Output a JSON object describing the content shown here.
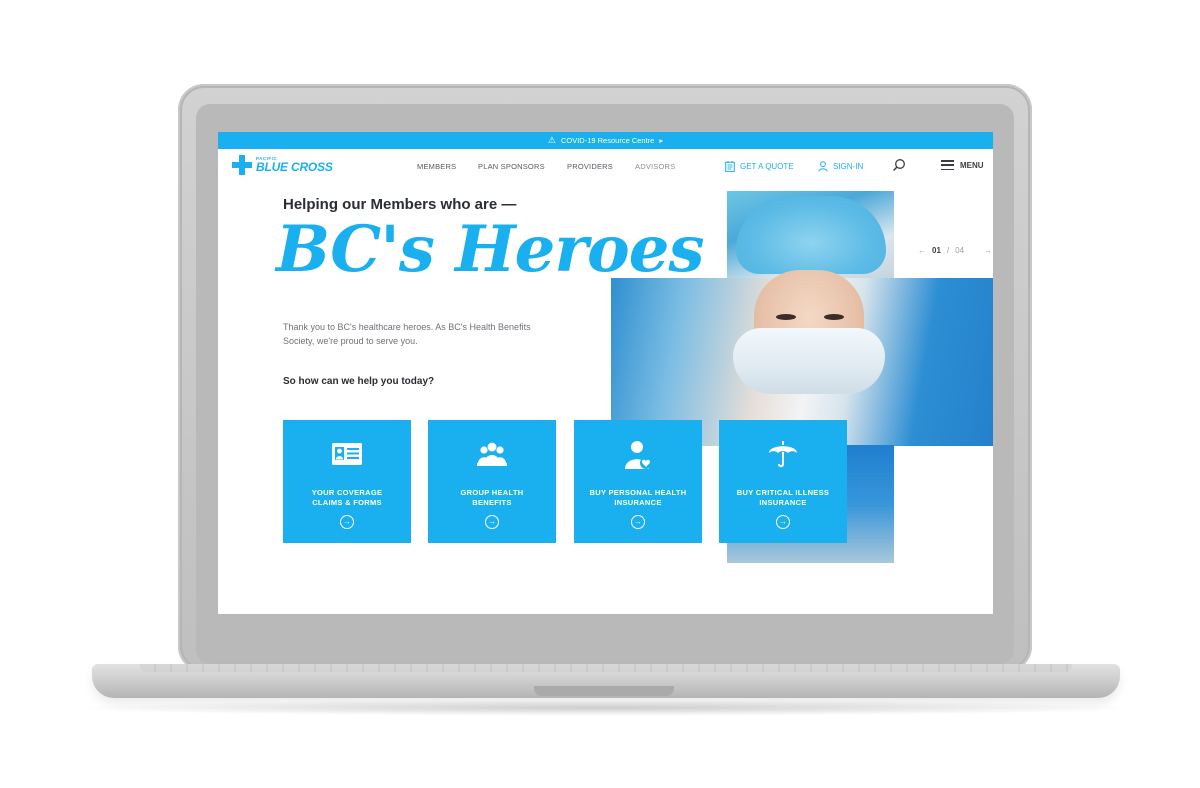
{
  "covid_bar": {
    "text": "COVID-19 Resource Centre",
    "arrow": "▸"
  },
  "logo": {
    "small": "PACIFIC",
    "big": "BLUE CROSS"
  },
  "nav": {
    "members": "MEMBERS",
    "plan_sponsors": "PLAN SPONSORS",
    "providers": "PROVIDERS",
    "advisors": "ADVISORS",
    "quote": "GET A QUOTE",
    "signin": "SIGN-IN",
    "menu": "MENU"
  },
  "hero": {
    "headline_small": "Helping our Members who are —",
    "headline_big": "BC's Heroes",
    "intro": "Thank you to BC's healthcare heroes. As BC's Health Benefits Society, we're proud to serve you.",
    "question": "So how can we help you today?"
  },
  "pager": {
    "prev": "←",
    "current": "01",
    "separator": "/",
    "total": "04",
    "next": "→"
  },
  "tiles": [
    {
      "line1": "YOUR COVERAGE",
      "line2": "CLAIMS & FORMS",
      "icon": "id-card-icon"
    },
    {
      "line1": "GROUP HEALTH",
      "line2": "BENEFITS",
      "icon": "group-icon"
    },
    {
      "line1": "BUY PERSONAL HEALTH",
      "line2": "INSURANCE",
      "icon": "person-heart-icon"
    },
    {
      "line1": "BUY CRITICAL ILLNESS",
      "line2": "INSURANCE",
      "icon": "umbrella-icon"
    }
  ],
  "colors": {
    "brand": "#1ab0ef",
    "text_dark": "#2a2d31",
    "text_muted": "#6e7378"
  }
}
